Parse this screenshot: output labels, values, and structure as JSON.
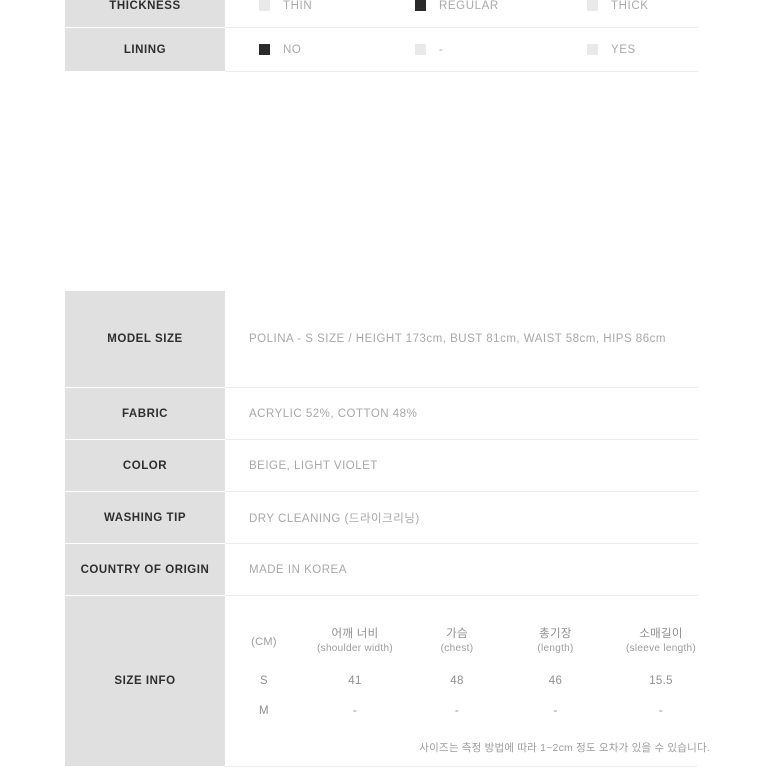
{
  "attributes_table": {
    "rows": [
      {
        "label": "THICKNESS",
        "options": [
          {
            "text": "THIN",
            "checked": false
          },
          {
            "text": "REGULAR",
            "checked": true
          },
          {
            "text": "THICK",
            "checked": false
          }
        ]
      },
      {
        "label": "LINING",
        "options": [
          {
            "text": "NO",
            "checked": true
          },
          {
            "text": "-",
            "checked": false
          },
          {
            "text": "YES",
            "checked": false
          }
        ]
      }
    ]
  },
  "details_table": {
    "rows": [
      {
        "label": "MODEL SIZE",
        "value": "POLINA - S SIZE / HEIGHT 173cm, BUST 81cm, WAIST 58cm, HIPS 86cm"
      },
      {
        "label": "FABRIC",
        "value": "ACRYLIC 52%, COTTON 48%"
      },
      {
        "label": "COLOR",
        "value": "BEIGE, LIGHT VIOLET"
      },
      {
        "label": "WASHING TIP",
        "value": "DRY CLEANING (드라이크리닝)"
      },
      {
        "label": "COUNTRY OF ORIGIN",
        "value": "MADE IN KOREA"
      }
    ]
  },
  "size_info": {
    "label": "SIZE INFO",
    "unit_header": "(CM)",
    "columns": [
      {
        "kr": "어깨 너비",
        "en": "(shoulder width)"
      },
      {
        "kr": "가슴",
        "en": "(chest)"
      },
      {
        "kr": "총기장",
        "en": "(length)"
      },
      {
        "kr": "소매길이",
        "en": "(sleeve length)"
      }
    ],
    "rows": [
      {
        "size": "S",
        "shoulder": "41",
        "chest": "48",
        "length": "46",
        "sleeve": "15.5"
      },
      {
        "size": "M",
        "shoulder": "-",
        "chest": "-",
        "length": "-",
        "sleeve": "-"
      }
    ],
    "note": "사이즈는 측정 방법에 따라 1~2cm 정도 오차가 있을 수 있습니다."
  },
  "colors": {
    "label_background": "#e0e0e0",
    "checkbox_checked": "#2a2a2a",
    "checkbox_unchecked": "#e9e9e9",
    "value_text": "#a8a8a8",
    "label_text": "#2e2e2e"
  }
}
